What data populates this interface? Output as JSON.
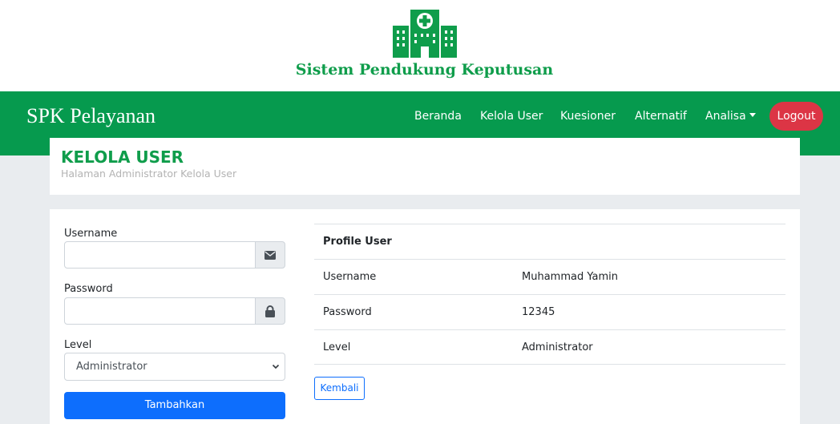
{
  "brand": {
    "logo_icon": "hospital-icon",
    "title": "Sistem Pendukung Keputusan",
    "color": "#0f9d4b"
  },
  "navbar": {
    "brand": "SPK Pelayanan",
    "background": "#069a4e",
    "items": [
      {
        "label": "Beranda"
      },
      {
        "label": "Kelola User"
      },
      {
        "label": "Kuesioner"
      },
      {
        "label": "Alternatif"
      },
      {
        "label": "Analisa",
        "dropdown": true
      }
    ],
    "logout_label": "Logout",
    "logout_color": "#dc3545"
  },
  "page": {
    "title": "KELOLA USER",
    "subtitle": "Halaman Administrator Kelola User"
  },
  "form": {
    "username_label": "Username",
    "username_value": "",
    "username_icon": "envelope-icon",
    "password_label": "Password",
    "password_value": "",
    "password_icon": "lock-icon",
    "level_label": "Level",
    "level_selected": "Administrator",
    "submit_label": "Tambahkan",
    "submit_color": "#0d6efd"
  },
  "profile": {
    "heading": "Profile User",
    "rows": [
      {
        "key": "Username",
        "value": "Muhammad Yamin"
      },
      {
        "key": "Password",
        "value": "12345"
      },
      {
        "key": "Level",
        "value": "Administrator"
      }
    ],
    "back_label": "Kembali"
  }
}
